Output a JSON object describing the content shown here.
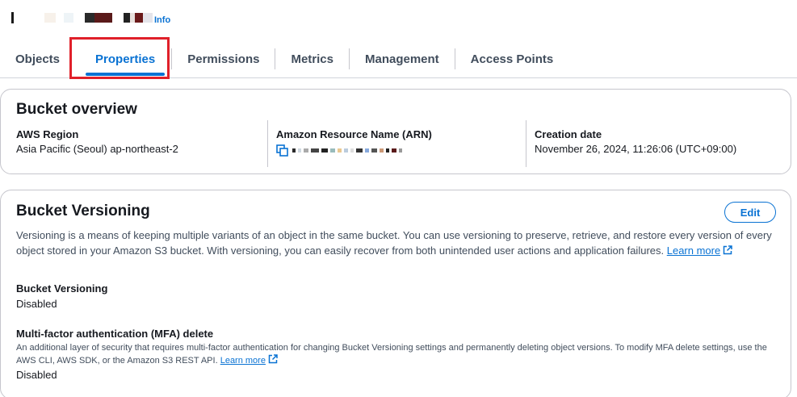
{
  "header": {
    "info_link": "Info"
  },
  "tabs": [
    {
      "label": "Objects"
    },
    {
      "label": "Properties"
    },
    {
      "label": "Permissions"
    },
    {
      "label": "Metrics"
    },
    {
      "label": "Management"
    },
    {
      "label": "Access Points"
    }
  ],
  "active_tab": "Properties",
  "colors": {
    "accent": "#0972d3",
    "highlight": "#e0202a"
  },
  "overview": {
    "title": "Bucket overview",
    "region_label": "AWS Region",
    "region_value": "Asia Pacific (Seoul) ap-northeast-2",
    "arn_label": "Amazon Resource Name (ARN)",
    "creation_label": "Creation date",
    "creation_value": "November 26, 2024, 11:26:06 (UTC+09:00)"
  },
  "versioning": {
    "title": "Bucket Versioning",
    "edit_label": "Edit",
    "description": "Versioning is a means of keeping multiple variants of an object in the same bucket. You can use versioning to preserve, retrieve, and restore every version of every object stored in your Amazon S3 bucket. With versioning, you can easily recover from both unintended user actions and application failures.",
    "learn_more": "Learn more",
    "status_label": "Bucket Versioning",
    "status_value": "Disabled",
    "mfa_label": "Multi-factor authentication (MFA) delete",
    "mfa_description": "An additional layer of security that requires multi-factor authentication for changing Bucket Versioning settings and permanently deleting object versions. To modify MFA delete settings, use the AWS CLI, AWS SDK, or the Amazon S3 REST API.",
    "mfa_learn_more": "Learn more",
    "mfa_value": "Disabled"
  }
}
